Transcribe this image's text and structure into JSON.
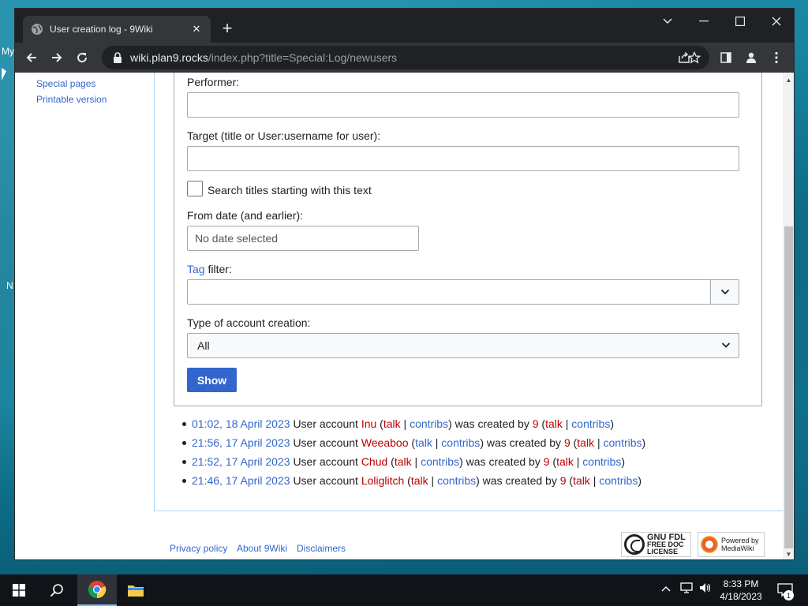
{
  "desktop": {
    "labels": [
      "My",
      "N"
    ]
  },
  "browser": {
    "tab_title": "User creation log - 9Wiki",
    "url_host": "wiki.plan9.rocks",
    "url_path": "/index.php?title=Special:Log/newusers"
  },
  "sidebar": {
    "items": [
      {
        "label": "Special pages"
      },
      {
        "label": "Printable version"
      }
    ]
  },
  "form": {
    "performer_label": "Performer:",
    "performer_value": "",
    "target_label": "Target (title or User:username for user):",
    "target_value": "",
    "prefix_checkbox_label": "Search titles starting with this text",
    "prefix_checked": false,
    "from_date_label": "From date (and earlier):",
    "from_date_placeholder": "No date selected",
    "tag_label_link": "Tag",
    "tag_label_rest": " filter:",
    "tag_value": "",
    "type_label": "Type of account creation:",
    "type_selected": "All",
    "show_label": "Show"
  },
  "log": {
    "entries": [
      {
        "timestamp": "01:02, 18 April 2023",
        "prefix": "User account",
        "account": "Inu",
        "account_missing": true,
        "talk": "talk",
        "talk_missing": true,
        "contribs": "contribs",
        "created_by_text": "was created by",
        "creator": "9",
        "creator_talk": "talk",
        "creator_talk_missing": true,
        "creator_contribs": "contribs"
      },
      {
        "timestamp": "21:56, 17 April 2023",
        "prefix": "User account",
        "account": "Weeaboo",
        "account_missing": true,
        "talk": "talk",
        "talk_missing": false,
        "contribs": "contribs",
        "created_by_text": "was created by",
        "creator": "9",
        "creator_talk": "talk",
        "creator_talk_missing": true,
        "creator_contribs": "contribs"
      },
      {
        "timestamp": "21:52, 17 April 2023",
        "prefix": "User account",
        "account": "Chud",
        "account_missing": true,
        "talk": "talk",
        "talk_missing": true,
        "contribs": "contribs",
        "created_by_text": "was created by",
        "creator": "9",
        "creator_talk": "talk",
        "creator_talk_missing": true,
        "creator_contribs": "contribs"
      },
      {
        "timestamp": "21:46, 17 April 2023",
        "prefix": "User account",
        "account": "Loliglitch",
        "account_missing": true,
        "talk": "talk",
        "talk_missing": true,
        "contribs": "contribs",
        "created_by_text": "was created by",
        "creator": "9",
        "creator_talk": "talk",
        "creator_talk_missing": true,
        "creator_contribs": "contribs"
      }
    ]
  },
  "footer": {
    "links": [
      "Privacy policy",
      "About 9Wiki",
      "Disclaimers"
    ],
    "gnu_badge_lines": [
      "GNU FDL",
      "FREE DOC",
      "LICENSE"
    ],
    "mediawiki_badge_lines": [
      "Powered by",
      "MediaWiki"
    ]
  },
  "taskbar": {
    "time": "8:33 PM",
    "date": "4/18/2023",
    "notification_count": "1"
  },
  "colors": {
    "link": "#3366cc",
    "missing_link": "#ba0000",
    "accent_button": "#3366cc",
    "chrome_dark": "#202124",
    "chrome_toolbar": "#35363a"
  },
  "icons": [
    "globe-icon",
    "close-icon",
    "plus-icon",
    "chevron-down-icon",
    "minimize-icon",
    "maximize-icon",
    "back-icon",
    "forward-icon",
    "reload-icon",
    "lock-icon",
    "share-icon",
    "star-icon",
    "side-panel-icon",
    "profile-icon",
    "kebab-menu-icon",
    "windows-start-icon",
    "search-icon",
    "chrome-icon",
    "file-explorer-icon",
    "network-icon",
    "volume-icon",
    "notification-icon"
  ]
}
